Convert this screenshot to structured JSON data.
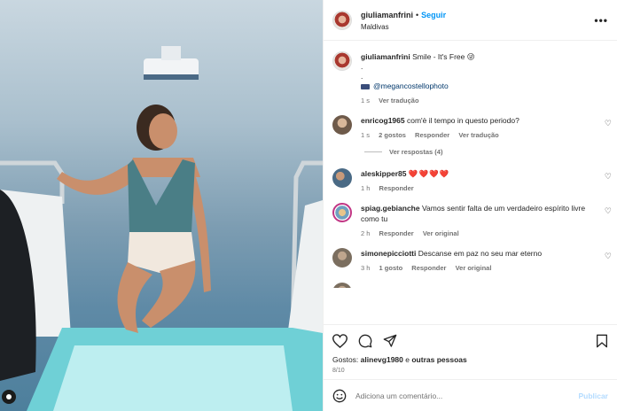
{
  "post": {
    "username": "giuliamanfrini",
    "follow_label": "Seguir",
    "location": "Maldivas",
    "caption_user": "giuliamanfrini",
    "caption_text": "Smile - It's Free",
    "caption_emoji": "😜",
    "caption_dot1": ".",
    "caption_dot2": ".",
    "caption_mention": "@megancostellophoto",
    "caption_time": "1 s",
    "caption_translate": "Ver tradução"
  },
  "comments": [
    {
      "user": "enricog1965",
      "text": "com'è il tempo in questo periodo?",
      "time": "1 s",
      "likes": "2 gostos",
      "reply": "Responder",
      "extra": "Ver tradução"
    },
    {
      "user": "aleskipper85",
      "text": "❤️❤️❤️❤️",
      "time": "1 h",
      "reply": "Responder"
    },
    {
      "user": "spiag.gebianche",
      "text": "Vamos sentir falta de um verdadeiro espírito livre como tu",
      "time": "2 h",
      "reply": "Responder",
      "extra": "Ver original"
    },
    {
      "user": "simonepicciotti",
      "text": "Descanse em paz no seu mar eterno",
      "time": "3 h",
      "likes": "1 gosto",
      "reply": "Responder",
      "extra": "Ver original"
    }
  ],
  "view_replies": "Ver respostas (4)",
  "likes_label": "Gostos:",
  "likes_user": "alinevg1980",
  "likes_and": "e",
  "likes_others": "outras pessoas",
  "date": "8/10",
  "add_comment": {
    "placeholder": "Adiciona um comentário...",
    "publish_label": "Publicar"
  },
  "icons": {
    "more": "more-options-icon",
    "like": "heart-icon",
    "comment": "comment-icon",
    "share": "share-icon",
    "save": "bookmark-icon",
    "emoji": "emoji-icon"
  },
  "colors": {
    "link": "#0095f6",
    "mention": "#00376b",
    "heart": "#ed2b3a"
  }
}
